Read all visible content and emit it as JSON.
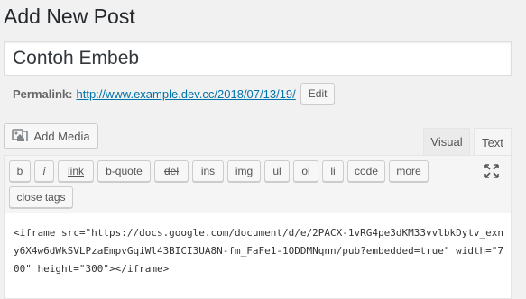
{
  "page": {
    "title": "Add New Post"
  },
  "post": {
    "title_value": "Contoh Embeb"
  },
  "permalink": {
    "label": "Permalink:",
    "url": "http://www.example.dev.cc/2018/07/13/19/",
    "edit_label": "Edit"
  },
  "media": {
    "add_media_label": "Add Media",
    "icon": "media-icon"
  },
  "tabs": {
    "visual_label": "Visual",
    "text_label": "Text",
    "active": "Text"
  },
  "toolbar": {
    "buttons": [
      {
        "label": "b"
      },
      {
        "label": "i"
      },
      {
        "label": "link"
      },
      {
        "label": "b-quote"
      },
      {
        "label": "del"
      },
      {
        "label": "ins"
      },
      {
        "label": "img"
      },
      {
        "label": "ul"
      },
      {
        "label": "ol"
      },
      {
        "label": "li"
      },
      {
        "label": "code"
      },
      {
        "label": "more"
      }
    ],
    "close_tags_label": "close tags",
    "fullscreen_icon": "fullscreen-icon"
  },
  "editor": {
    "content": "<iframe src=\"https://docs.google.com/document/d/e/2PACX-1vRG4pe3dKM33vvlbkDytv_exny6X4w6dWkSVLPzaEmpvGqiWl43BICI3UA8N-fm_FaFe1-1ODDMNqnn/pub?embedded=true\" width=\"700\" height=\"300\"></iframe>"
  }
}
